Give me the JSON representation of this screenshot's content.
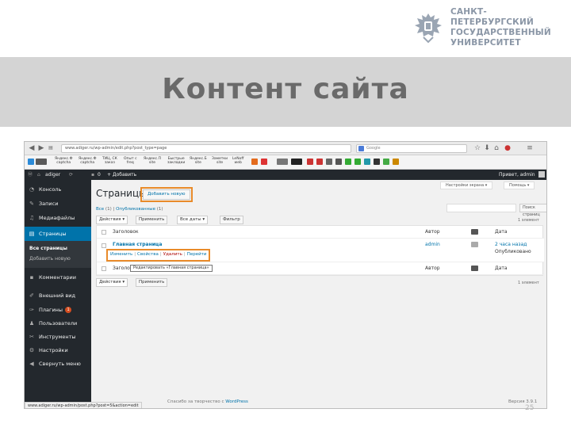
{
  "slide": {
    "title": "Контент сайта",
    "page_number": "25",
    "logo_lines": [
      "САНКТ-ПЕТЕРБУРГСКИЙ",
      "ГОСУДАРСТВЕННЫЙ",
      "УНИВЕРСИТЕТ"
    ],
    "logo_color": "#8a96a6",
    "band_color": "#d4d4d4"
  },
  "browser": {
    "url": "www.adiger.ru/wp-admin/edit.php?post_type=page",
    "search_placeholder": "Google"
  },
  "bookmarks": [
    {
      "label": "Яндекс.Ф\ncaptcha"
    },
    {
      "label": "Яндекс.Ф\ncaptcha"
    },
    {
      "label": "ТИЦ, СК\nзаказ"
    },
    {
      "label": "Опыт с\nfreq"
    },
    {
      "label": "Яндекс.П\nsite"
    },
    {
      "label": "Быстрые\nзакладки"
    },
    {
      "label": "Яндекс.Б\nsite"
    },
    {
      "label": "Заметки\nsite"
    },
    {
      "label": "LeNoff\nweb"
    }
  ],
  "adminbar": {
    "site_name": "adiger",
    "comments_count": "0",
    "add_label": "+ Добавить",
    "greeting": "Привет, admin"
  },
  "sidebar": {
    "items": [
      {
        "label": "Консоль",
        "icon": "dashboard-icon"
      },
      {
        "label": "Записи",
        "icon": "pin-icon"
      },
      {
        "label": "Медиафайлы",
        "icon": "media-icon"
      },
      {
        "label": "Страницы",
        "icon": "pages-icon"
      },
      {
        "label": "Комментарии",
        "icon": "comments-icon"
      },
      {
        "label": "Внешний вид",
        "icon": "appearance-icon"
      },
      {
        "label": "Плагины",
        "icon": "plugins-icon",
        "badge": "1"
      },
      {
        "label": "Пользователи",
        "icon": "users-icon"
      },
      {
        "label": "Инструменты",
        "icon": "tools-icon"
      },
      {
        "label": "Настройки",
        "icon": "settings-icon"
      },
      {
        "label": "Свернуть меню",
        "icon": "collapse-icon"
      }
    ],
    "submenu": [
      "Все страницы",
      "Добавить новую"
    ]
  },
  "main": {
    "heading": "Страницы",
    "add_new_label": "Добавить новую",
    "screen_options": "Настройки экрана ▾",
    "help": "Помощь ▾",
    "views_all": "Все",
    "views_all_count": " (1) | ",
    "views_published": "Опубликованные",
    "views_published_count": " (1)",
    "search_button": "Поиск страниц",
    "bulk_actions": "Действия ▾",
    "apply": "Применить",
    "all_dates": "Все даты ▾",
    "filter": "Фильтр",
    "items_count": "1 элемент",
    "columns": {
      "title": "Заголовок",
      "author": "Автор",
      "date": "Дата"
    },
    "row": {
      "title": "Главная страница",
      "author": "admin",
      "date_1": "2 часа назад",
      "date_2": "Опубликовано",
      "actions": [
        "Изменить",
        "Свойства",
        "Удалить",
        "Перейти"
      ]
    },
    "tooltip": "Редактировать «Главная страница»",
    "footer_url": "www.adiger.ru/wp-admin/post.php?post=5&action=edit",
    "footer_thanks_prefix": "Спасибо за творчество с ",
    "footer_thanks_link": "WordPress",
    "version": "Версия 3.9.1"
  }
}
